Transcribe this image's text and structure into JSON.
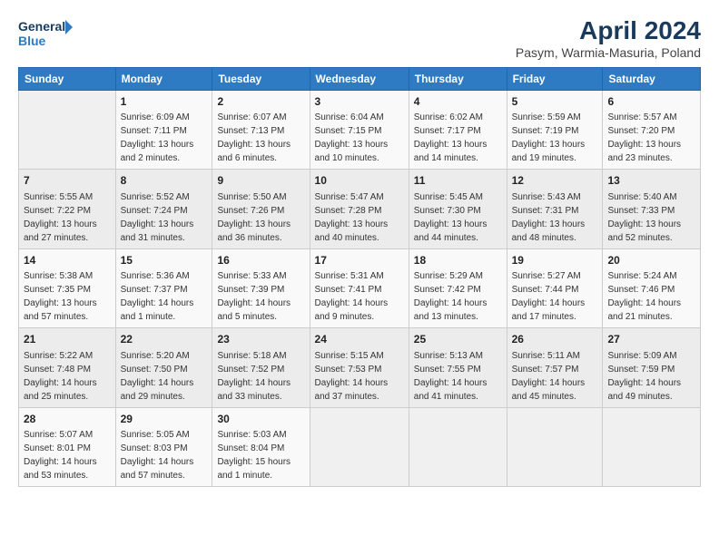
{
  "header": {
    "logo_line1": "General",
    "logo_line2": "Blue",
    "title": "April 2024",
    "subtitle": "Pasym, Warmia-Masuria, Poland"
  },
  "days_of_week": [
    "Sunday",
    "Monday",
    "Tuesday",
    "Wednesday",
    "Thursday",
    "Friday",
    "Saturday"
  ],
  "weeks": [
    [
      {
        "num": "",
        "info": ""
      },
      {
        "num": "1",
        "info": "Sunrise: 6:09 AM\nSunset: 7:11 PM\nDaylight: 13 hours\nand 2 minutes."
      },
      {
        "num": "2",
        "info": "Sunrise: 6:07 AM\nSunset: 7:13 PM\nDaylight: 13 hours\nand 6 minutes."
      },
      {
        "num": "3",
        "info": "Sunrise: 6:04 AM\nSunset: 7:15 PM\nDaylight: 13 hours\nand 10 minutes."
      },
      {
        "num": "4",
        "info": "Sunrise: 6:02 AM\nSunset: 7:17 PM\nDaylight: 13 hours\nand 14 minutes."
      },
      {
        "num": "5",
        "info": "Sunrise: 5:59 AM\nSunset: 7:19 PM\nDaylight: 13 hours\nand 19 minutes."
      },
      {
        "num": "6",
        "info": "Sunrise: 5:57 AM\nSunset: 7:20 PM\nDaylight: 13 hours\nand 23 minutes."
      }
    ],
    [
      {
        "num": "7",
        "info": "Sunrise: 5:55 AM\nSunset: 7:22 PM\nDaylight: 13 hours\nand 27 minutes."
      },
      {
        "num": "8",
        "info": "Sunrise: 5:52 AM\nSunset: 7:24 PM\nDaylight: 13 hours\nand 31 minutes."
      },
      {
        "num": "9",
        "info": "Sunrise: 5:50 AM\nSunset: 7:26 PM\nDaylight: 13 hours\nand 36 minutes."
      },
      {
        "num": "10",
        "info": "Sunrise: 5:47 AM\nSunset: 7:28 PM\nDaylight: 13 hours\nand 40 minutes."
      },
      {
        "num": "11",
        "info": "Sunrise: 5:45 AM\nSunset: 7:30 PM\nDaylight: 13 hours\nand 44 minutes."
      },
      {
        "num": "12",
        "info": "Sunrise: 5:43 AM\nSunset: 7:31 PM\nDaylight: 13 hours\nand 48 minutes."
      },
      {
        "num": "13",
        "info": "Sunrise: 5:40 AM\nSunset: 7:33 PM\nDaylight: 13 hours\nand 52 minutes."
      }
    ],
    [
      {
        "num": "14",
        "info": "Sunrise: 5:38 AM\nSunset: 7:35 PM\nDaylight: 13 hours\nand 57 minutes."
      },
      {
        "num": "15",
        "info": "Sunrise: 5:36 AM\nSunset: 7:37 PM\nDaylight: 14 hours\nand 1 minute."
      },
      {
        "num": "16",
        "info": "Sunrise: 5:33 AM\nSunset: 7:39 PM\nDaylight: 14 hours\nand 5 minutes."
      },
      {
        "num": "17",
        "info": "Sunrise: 5:31 AM\nSunset: 7:41 PM\nDaylight: 14 hours\nand 9 minutes."
      },
      {
        "num": "18",
        "info": "Sunrise: 5:29 AM\nSunset: 7:42 PM\nDaylight: 14 hours\nand 13 minutes."
      },
      {
        "num": "19",
        "info": "Sunrise: 5:27 AM\nSunset: 7:44 PM\nDaylight: 14 hours\nand 17 minutes."
      },
      {
        "num": "20",
        "info": "Sunrise: 5:24 AM\nSunset: 7:46 PM\nDaylight: 14 hours\nand 21 minutes."
      }
    ],
    [
      {
        "num": "21",
        "info": "Sunrise: 5:22 AM\nSunset: 7:48 PM\nDaylight: 14 hours\nand 25 minutes."
      },
      {
        "num": "22",
        "info": "Sunrise: 5:20 AM\nSunset: 7:50 PM\nDaylight: 14 hours\nand 29 minutes."
      },
      {
        "num": "23",
        "info": "Sunrise: 5:18 AM\nSunset: 7:52 PM\nDaylight: 14 hours\nand 33 minutes."
      },
      {
        "num": "24",
        "info": "Sunrise: 5:15 AM\nSunset: 7:53 PM\nDaylight: 14 hours\nand 37 minutes."
      },
      {
        "num": "25",
        "info": "Sunrise: 5:13 AM\nSunset: 7:55 PM\nDaylight: 14 hours\nand 41 minutes."
      },
      {
        "num": "26",
        "info": "Sunrise: 5:11 AM\nSunset: 7:57 PM\nDaylight: 14 hours\nand 45 minutes."
      },
      {
        "num": "27",
        "info": "Sunrise: 5:09 AM\nSunset: 7:59 PM\nDaylight: 14 hours\nand 49 minutes."
      }
    ],
    [
      {
        "num": "28",
        "info": "Sunrise: 5:07 AM\nSunset: 8:01 PM\nDaylight: 14 hours\nand 53 minutes."
      },
      {
        "num": "29",
        "info": "Sunrise: 5:05 AM\nSunset: 8:03 PM\nDaylight: 14 hours\nand 57 minutes."
      },
      {
        "num": "30",
        "info": "Sunrise: 5:03 AM\nSunset: 8:04 PM\nDaylight: 15 hours\nand 1 minute."
      },
      {
        "num": "",
        "info": ""
      },
      {
        "num": "",
        "info": ""
      },
      {
        "num": "",
        "info": ""
      },
      {
        "num": "",
        "info": ""
      }
    ]
  ]
}
